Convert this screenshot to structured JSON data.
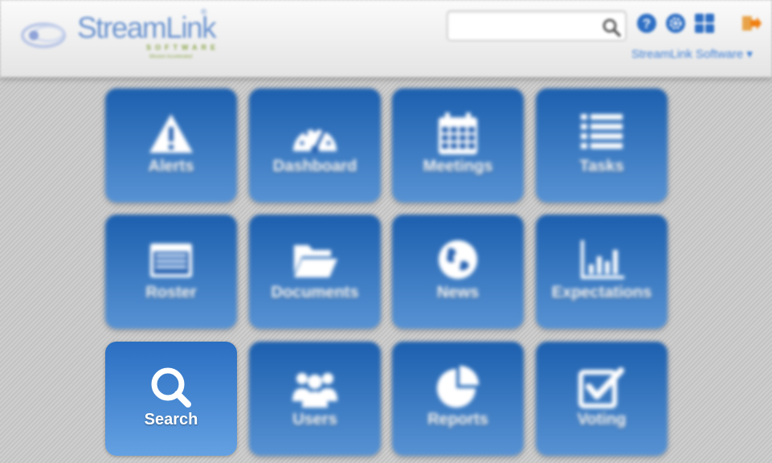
{
  "header": {
    "logo": {
      "name": "StreamLink",
      "trademark": "®",
      "tagline": "SOFTWARE",
      "subtitle": "Mission Accelerated"
    },
    "search": {
      "value": "",
      "placeholder": ""
    },
    "icons": [
      "help-icon",
      "settings-icon",
      "apps-grid-icon",
      "logout-icon"
    ],
    "account_label": "StreamLink Software ▾"
  },
  "tiles": [
    {
      "label": "Alerts",
      "icon": "alert-icon"
    },
    {
      "label": "Dashboard",
      "icon": "gauge-icon"
    },
    {
      "label": "Meetings",
      "icon": "calendar-icon"
    },
    {
      "label": "Tasks",
      "icon": "list-icon"
    },
    {
      "label": "Roster",
      "icon": "roster-icon"
    },
    {
      "label": "Documents",
      "icon": "folder-icon"
    },
    {
      "label": "News",
      "icon": "globe-icon"
    },
    {
      "label": "Expectations",
      "icon": "bar-chart-icon"
    },
    {
      "label": "Search",
      "icon": "search-icon",
      "active": true
    },
    {
      "label": "Users",
      "icon": "users-icon"
    },
    {
      "label": "Reports",
      "icon": "pie-chart-icon"
    },
    {
      "label": "Voting",
      "icon": "checkbox-icon"
    }
  ],
  "colors": {
    "tile_top": "#1c5fae",
    "tile_bottom": "#5792d3",
    "link": "#3e7fd6",
    "logout": "#f0a020"
  }
}
